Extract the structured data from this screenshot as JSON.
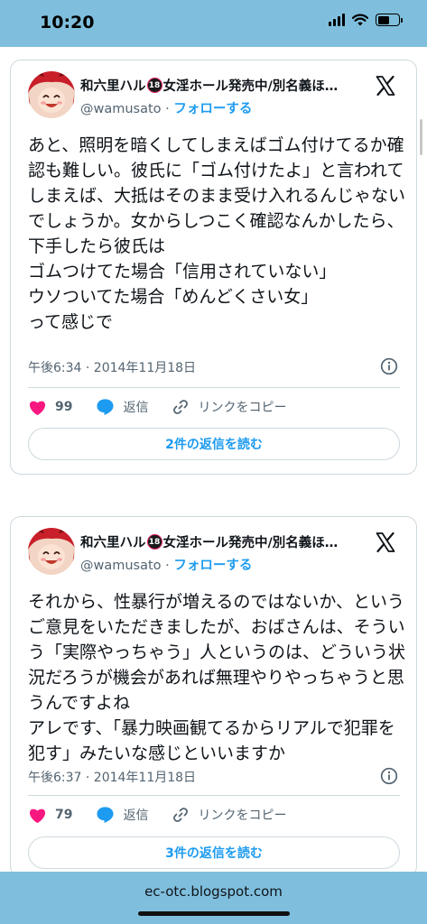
{
  "status_bar": {
    "time": "10:20",
    "background": "#7fbfdd"
  },
  "tweets": [
    {
      "author_name_prefix": "和六里ハル",
      "badge_text": "18",
      "author_name_suffix": "女淫ホール発売中/別名義ほ…",
      "handle": "@wamusato",
      "separator": "·",
      "follow_label": "フォローする",
      "text": "あと、照明を暗くしてしまえばゴム付けてるか確認も難しい。彼氏に「ゴム付けたよ」と言われてしまえば、大抵はそのまま受け入れるんじゃないでしょうか。女からしつこく確認なんかしたら、下手したら彼氏は\nゴムつけてた場合「信用されていない」\nウソついてた場合「めんどくさい女」\nって感じで",
      "timestamp": "午後6:34 · 2014年11月18日",
      "likes": "99",
      "reply_label": "返信",
      "copy_link_label": "リンクをコピー",
      "replies_button": "2件の返信を読む"
    },
    {
      "author_name_prefix": "和六里ハル",
      "badge_text": "18",
      "author_name_suffix": "女淫ホール発売中/別名義ほ…",
      "handle": "@wamusato",
      "separator": "·",
      "follow_label": "フォローする",
      "text": "それから、性暴行が増えるのではないか、というご意見をいただきましたが、おばさんは、そういう「実際やっちゃう」人というのは、どういう状況だろうが機会があれば無理やりやっちゃうと思うんですよね\nアレです、「暴力映画観てるからリアルで犯罪を犯す」みたいな感じといいますか",
      "timestamp": "午後6:37 · 2014年11月18日",
      "likes": "79",
      "reply_label": "返信",
      "copy_link_label": "リンクをコピー",
      "replies_button": "3件の返信を読む"
    }
  ],
  "footer": {
    "url": "ec-otc.blogspot.com"
  },
  "colors": {
    "like": "#f91880",
    "accent": "#1d9bf0",
    "bar": "#7fbfdd"
  }
}
